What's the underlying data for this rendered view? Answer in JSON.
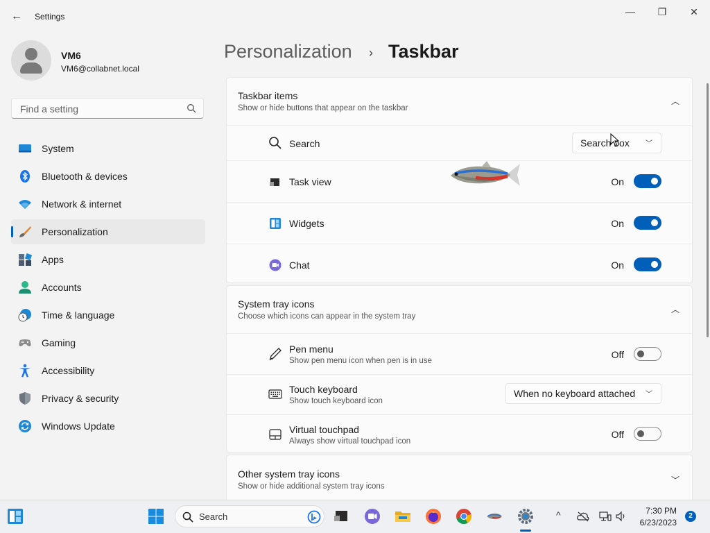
{
  "window": {
    "title": "Settings",
    "back_glyph": "←",
    "minimize_glyph": "—",
    "maximize_glyph": "❐",
    "close_glyph": "✕"
  },
  "account": {
    "name": "VM6",
    "email": "VM6@collabnet.local"
  },
  "search": {
    "placeholder": "Find a setting",
    "value": ""
  },
  "nav": {
    "items": [
      {
        "label": "System",
        "icon": "system-icon"
      },
      {
        "label": "Bluetooth & devices",
        "icon": "bluetooth-icon"
      },
      {
        "label": "Network & internet",
        "icon": "wifi-icon"
      },
      {
        "label": "Personalization",
        "icon": "brush-icon",
        "active": true
      },
      {
        "label": "Apps",
        "icon": "apps-icon"
      },
      {
        "label": "Accounts",
        "icon": "person-icon"
      },
      {
        "label": "Time & language",
        "icon": "clock-globe-icon"
      },
      {
        "label": "Gaming",
        "icon": "gamepad-icon"
      },
      {
        "label": "Accessibility",
        "icon": "accessibility-icon"
      },
      {
        "label": "Privacy & security",
        "icon": "shield-icon"
      },
      {
        "label": "Windows Update",
        "icon": "update-icon"
      }
    ]
  },
  "header": {
    "parent": "Personalization",
    "separator": "›",
    "current": "Taskbar"
  },
  "taskbar_items": {
    "title": "Taskbar items",
    "subtitle": "Show or hide buttons that appear on the taskbar",
    "rows": [
      {
        "label": "Search",
        "control": "dropdown",
        "value": "Search box"
      },
      {
        "label": "Task view",
        "control": "toggle",
        "state": "On"
      },
      {
        "label": "Widgets",
        "control": "toggle",
        "state": "On"
      },
      {
        "label": "Chat",
        "control": "toggle",
        "state": "On"
      }
    ]
  },
  "system_tray": {
    "title": "System tray icons",
    "subtitle": "Choose which icons can appear in the system tray",
    "rows": [
      {
        "label": "Pen menu",
        "description": "Show pen menu icon when pen is in use",
        "control": "toggle",
        "state": "Off"
      },
      {
        "label": "Touch keyboard",
        "description": "Show touch keyboard icon",
        "control": "dropdown",
        "value": "When no keyboard attached"
      },
      {
        "label": "Virtual touchpad",
        "description": "Always show virtual touchpad icon",
        "control": "toggle",
        "state": "Off"
      }
    ]
  },
  "other_tray": {
    "title": "Other system tray icons",
    "subtitle": "Show or hide additional system tray icons"
  },
  "taskbar": {
    "search_label": "Search",
    "time": "7:30 PM",
    "date": "6/23/2023",
    "notification_count": "2",
    "up_glyph": "^"
  },
  "colors": {
    "accent": "#005fb8",
    "background": "#f3f3f3",
    "card": "#fbfbfb"
  }
}
